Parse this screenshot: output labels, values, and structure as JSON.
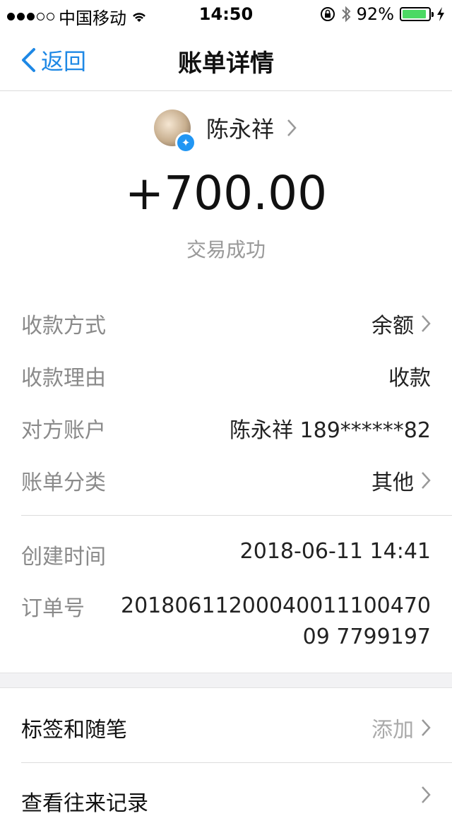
{
  "status_bar": {
    "carrier": "中国移动",
    "time": "14:50",
    "battery": "92%",
    "battery_level": 0.92
  },
  "nav": {
    "back_label": "返回",
    "title": "账单详情"
  },
  "profile": {
    "name": "陈永祥"
  },
  "amount": "+700.00",
  "status": "交易成功",
  "details": [
    {
      "label": "收款方式",
      "value": "余额"
    },
    {
      "label": "收款理由",
      "value": "收款"
    },
    {
      "label": "对方账户",
      "value": "陈永祥 189******82"
    },
    {
      "label": "账单分类",
      "value": "其他"
    }
  ],
  "meta": {
    "created_label": "创建时间",
    "created_value": "2018-06-11 14:41",
    "order_label": "订单号",
    "order_value": "2018061120004001110047009 7799197"
  },
  "actions": [
    {
      "label": "标签和随笔",
      "value": "添加"
    },
    {
      "label": "查看往来记录",
      "value": ""
    }
  ]
}
